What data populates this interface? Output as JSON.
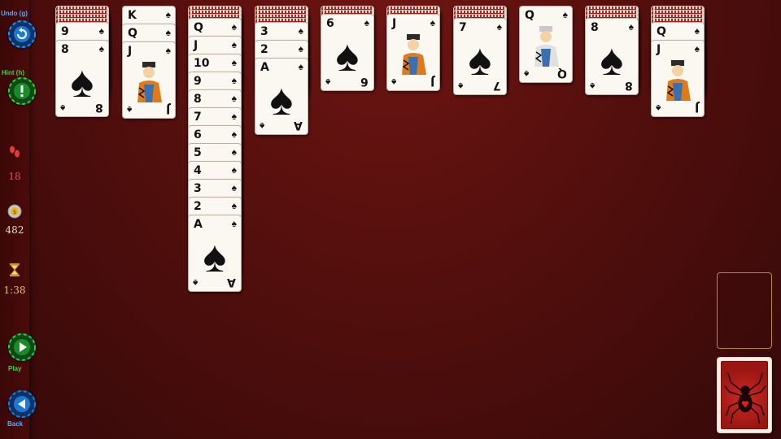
{
  "sidebar": {
    "undo_label": "Undo (g)",
    "hint_label": "Hint (h)",
    "moves_value": "18",
    "score_value": "482",
    "time_value": "1:38",
    "play_label": "Play",
    "back_label": "Back",
    "colors": {
      "undo": "#1e90ff",
      "hint": "#34d034",
      "play": "#2ecc40",
      "back": "#1e7fd8"
    }
  },
  "tableau": [
    {
      "hidden": 4,
      "cards": [
        "9",
        "8"
      ]
    },
    {
      "hidden": 0,
      "cards": [
        "K",
        "Q",
        "J"
      ]
    },
    {
      "hidden": 3,
      "cards": [
        "Q",
        "J",
        "10",
        "9",
        "8",
        "7",
        "6",
        "5",
        "4",
        "3",
        "2",
        "A"
      ]
    },
    {
      "hidden": 4,
      "cards": [
        "3",
        "2",
        "A"
      ]
    },
    {
      "hidden": 2,
      "cards": [
        "6"
      ]
    },
    {
      "hidden": 2,
      "cards": [
        "J"
      ]
    },
    {
      "hidden": 3,
      "cards": [
        "7"
      ]
    },
    {
      "hidden": 0,
      "cards": [
        "Q"
      ]
    },
    {
      "hidden": 3,
      "cards": [
        "8"
      ]
    },
    {
      "hidden": 4,
      "cards": [
        "Q",
        "J"
      ]
    }
  ],
  "suit": "♠",
  "stock": {
    "icon": "spider-icon"
  },
  "foundation": {
    "icon": "empty-foundation-slot"
  }
}
